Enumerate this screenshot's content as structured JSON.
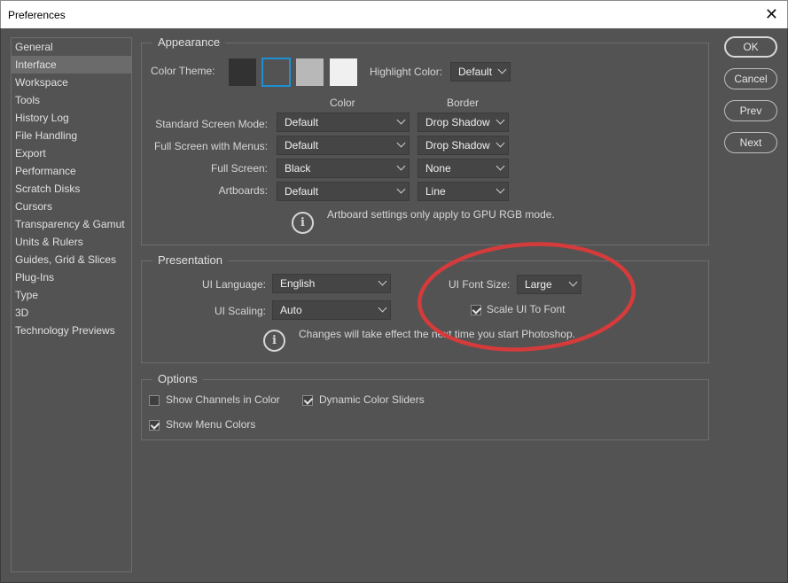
{
  "window": {
    "title": "Preferences"
  },
  "sidebar": {
    "items": [
      {
        "label": "General"
      },
      {
        "label": "Interface"
      },
      {
        "label": "Workspace"
      },
      {
        "label": "Tools"
      },
      {
        "label": "History Log"
      },
      {
        "label": "File Handling"
      },
      {
        "label": "Export"
      },
      {
        "label": "Performance"
      },
      {
        "label": "Scratch Disks"
      },
      {
        "label": "Cursors"
      },
      {
        "label": "Transparency & Gamut"
      },
      {
        "label": "Units & Rulers"
      },
      {
        "label": "Guides, Grid & Slices"
      },
      {
        "label": "Plug-Ins"
      },
      {
        "label": "Type"
      },
      {
        "label": "3D"
      },
      {
        "label": "Technology Previews"
      }
    ],
    "active_index": 1
  },
  "appearance": {
    "title": "Appearance",
    "color_theme_label": "Color Theme:",
    "swatch_colors": [
      "#323232",
      "#535353",
      "#b8b8b8",
      "#f0f0f0"
    ],
    "selected_theme_index": 1,
    "highlight_label": "Highlight Color:",
    "highlight_value": "Default",
    "col_color": "Color",
    "col_border": "Border",
    "rows": [
      {
        "label": "Standard Screen Mode:",
        "color": "Default",
        "border": "Drop Shadow"
      },
      {
        "label": "Full Screen with Menus:",
        "color": "Default",
        "border": "Drop Shadow"
      },
      {
        "label": "Full Screen:",
        "color": "Black",
        "border": "None"
      },
      {
        "label": "Artboards:",
        "color": "Default",
        "border": "Line"
      }
    ],
    "info_text": "Artboard settings only apply to GPU RGB mode."
  },
  "presentation": {
    "title": "Presentation",
    "ui_language_label": "UI Language:",
    "ui_language_value": "English",
    "ui_scaling_label": "UI Scaling:",
    "ui_scaling_value": "Auto",
    "font_size_label": "UI Font Size:",
    "font_size_value": "Large",
    "scale_ui_label": "Scale UI To Font",
    "scale_ui_checked": true,
    "info_text": "Changes will take effect the next time you start Photoshop."
  },
  "options": {
    "title": "Options",
    "show_channels_label": "Show Channels in Color",
    "show_channels_checked": false,
    "dynamic_sliders_label": "Dynamic Color Sliders",
    "dynamic_sliders_checked": true,
    "show_menu_colors_label": "Show Menu Colors",
    "show_menu_colors_checked": true
  },
  "buttons": {
    "ok": "OK",
    "cancel": "Cancel",
    "prev": "Prev",
    "next": "Next"
  },
  "annotation": {
    "color": "#d63b3b"
  }
}
